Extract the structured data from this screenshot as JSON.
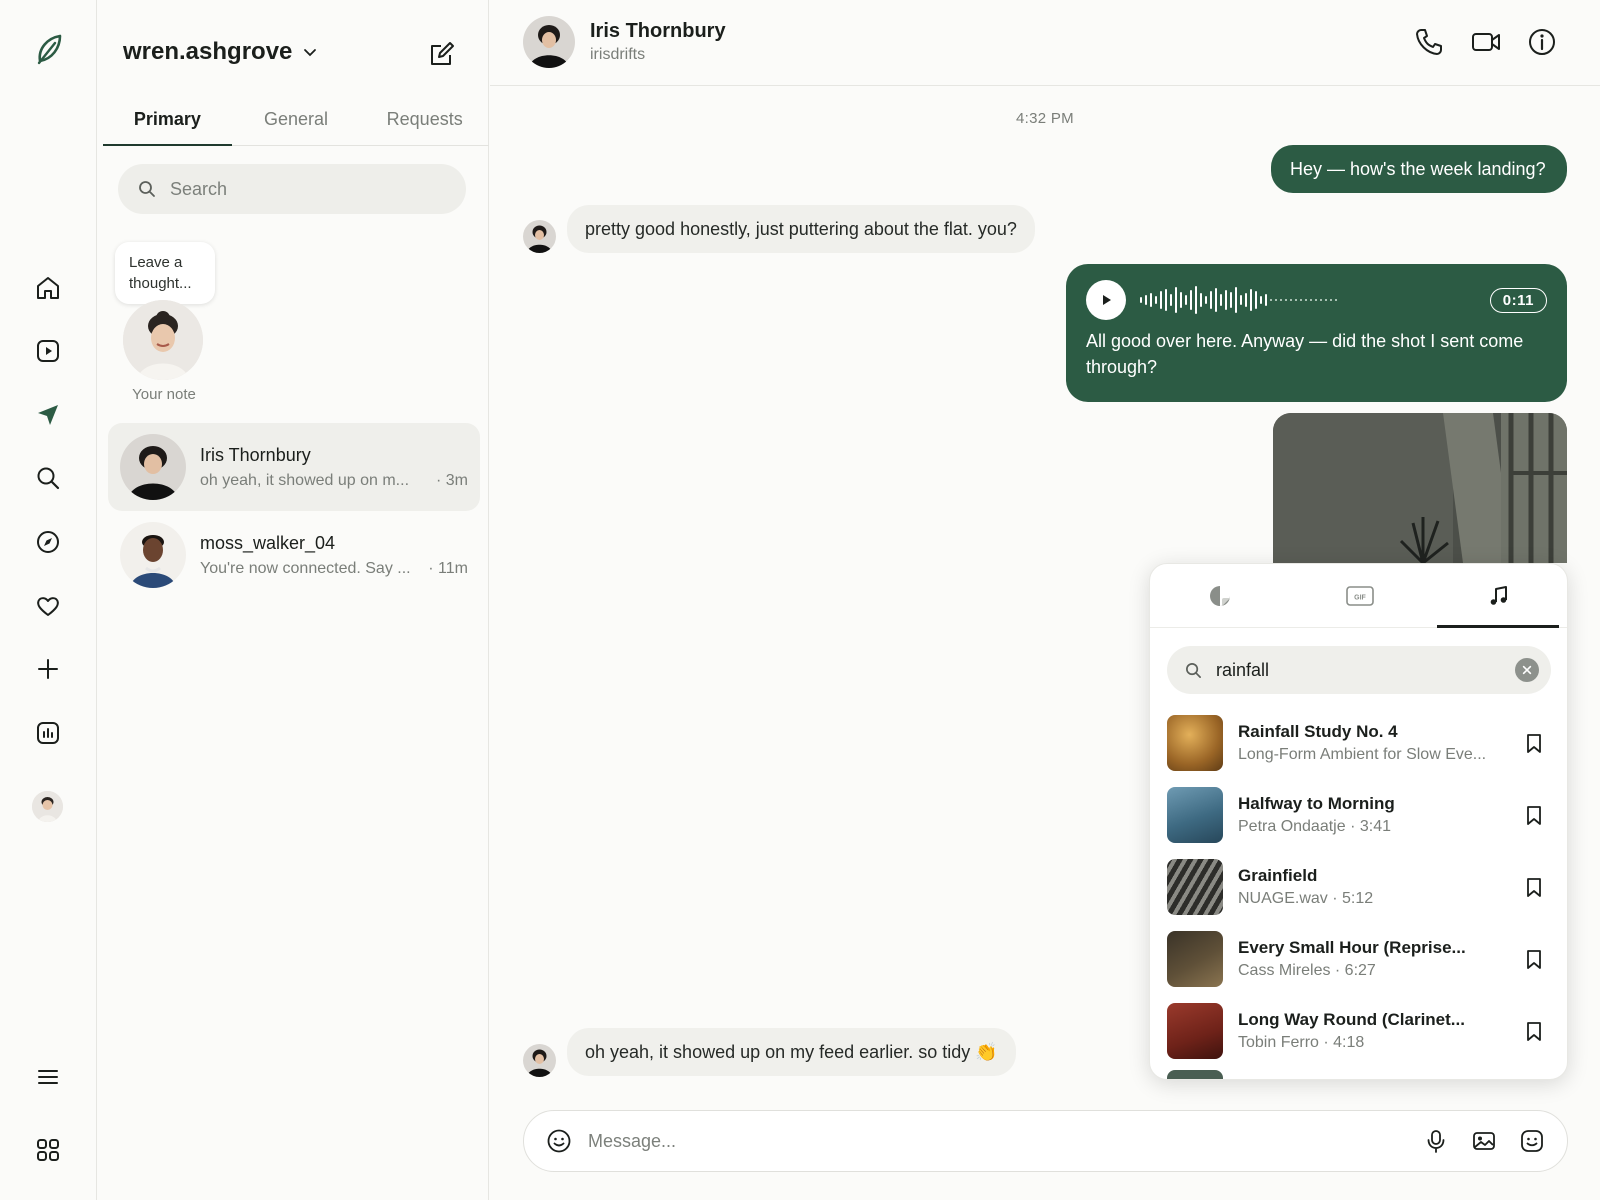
{
  "inbox": {
    "account_name": "wren.ashgrove",
    "tabs": [
      {
        "label": "Primary",
        "active": true
      },
      {
        "label": "General",
        "active": false
      },
      {
        "label": "Requests",
        "active": false
      }
    ],
    "search_placeholder": "Search",
    "note": {
      "bubble_text": "Leave a thought...",
      "label": "Your note"
    },
    "conversations": [
      {
        "name": "Iris Thornbury",
        "preview": "oh yeah, it showed up on m...",
        "time": "· 3m",
        "selected": true
      },
      {
        "name": "moss_walker_04",
        "preview": "You're now connected. Say ...",
        "time": "· 11m",
        "selected": false
      }
    ]
  },
  "chat": {
    "contact_name": "Iris Thornbury",
    "contact_handle": "irisdrifts",
    "timestamp": "4:32 PM",
    "messages": [
      {
        "from": "me",
        "text": "Hey — how's the week landing?"
      },
      {
        "from": "them",
        "text": "pretty good honestly, just puttering about the flat. you?"
      },
      {
        "from": "me",
        "type": "voice",
        "duration": "0:11",
        "text": "All good over here. Anyway — did the shot I sent come through?"
      },
      {
        "from": "me",
        "type": "photo"
      },
      {
        "from": "them",
        "text": "oh yeah, it showed up on my feed earlier. so tidy 👏"
      }
    ],
    "composer_placeholder": "Message..."
  },
  "picker": {
    "tabs": [
      "sticker-icon",
      "gif-icon",
      "music-icon"
    ],
    "active_tab": "music-icon",
    "gif_label": "GIF",
    "query": "rainfall",
    "tracks": [
      {
        "title": "Rainfall Study No. 4",
        "subtitle": "Long-Form Ambient for Slow Eve...",
        "art": "#b8843a"
      },
      {
        "title": "Halfway to Morning",
        "subtitle": "Petra Ondaatje · 3:41",
        "art": "#4f7f98"
      },
      {
        "title": "Grainfield",
        "subtitle": "NUAGE.wav · 5:12",
        "art": "#4a4a46"
      },
      {
        "title": "Every Small Hour (Reprise...",
        "subtitle": "Cass Mireles · 6:27",
        "art": "#5a4a33"
      },
      {
        "title": "Long Way Round (Clarinet...",
        "subtitle": "Tobin Ferro · 4:18",
        "art": "#7a2a22"
      }
    ]
  },
  "colors": {
    "accent": "#2c5b44",
    "incoming_bubble": "#f0f0ec",
    "background": "#fbfbf9"
  }
}
